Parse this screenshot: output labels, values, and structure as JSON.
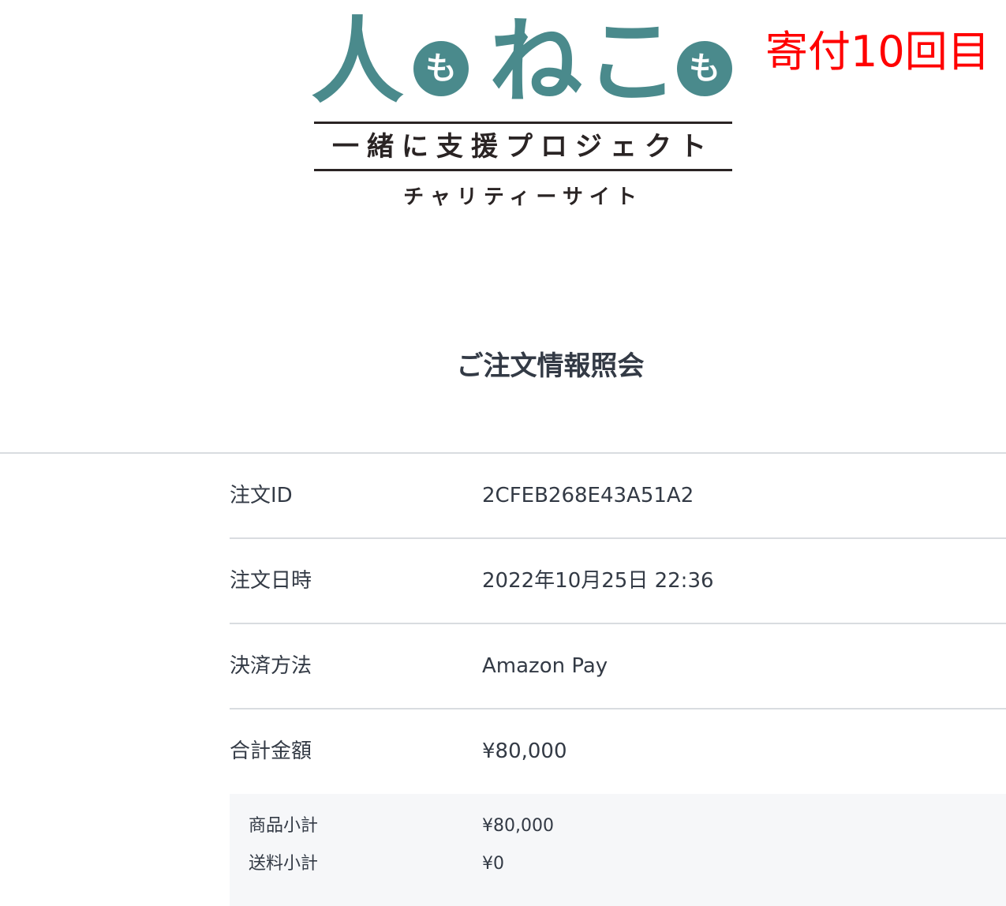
{
  "logo": {
    "word_hito": "人",
    "particle_1": "も",
    "word_neko": "ねこ",
    "particle_2": "も",
    "subtitle": "一緒に支援プロジェクト",
    "tagline": "チャリティーサイト",
    "brand_color": "#4a8a8c"
  },
  "overlay": {
    "note": "寄付10回目",
    "color": "#ff0000"
  },
  "page": {
    "title": "ご注文情報照会"
  },
  "order": {
    "rows": [
      {
        "label": "注文ID",
        "value": "2CFEB268E43A51A2"
      },
      {
        "label": "注文日時",
        "value": "2022年10月25日 22:36"
      },
      {
        "label": "決済方法",
        "value": "Amazon Pay"
      },
      {
        "label": "合計金額",
        "value": "¥80,000"
      }
    ],
    "breakdown": [
      {
        "label": "商品小計",
        "value": "¥80,000"
      },
      {
        "label": "送料小計",
        "value": "¥0"
      }
    ]
  }
}
